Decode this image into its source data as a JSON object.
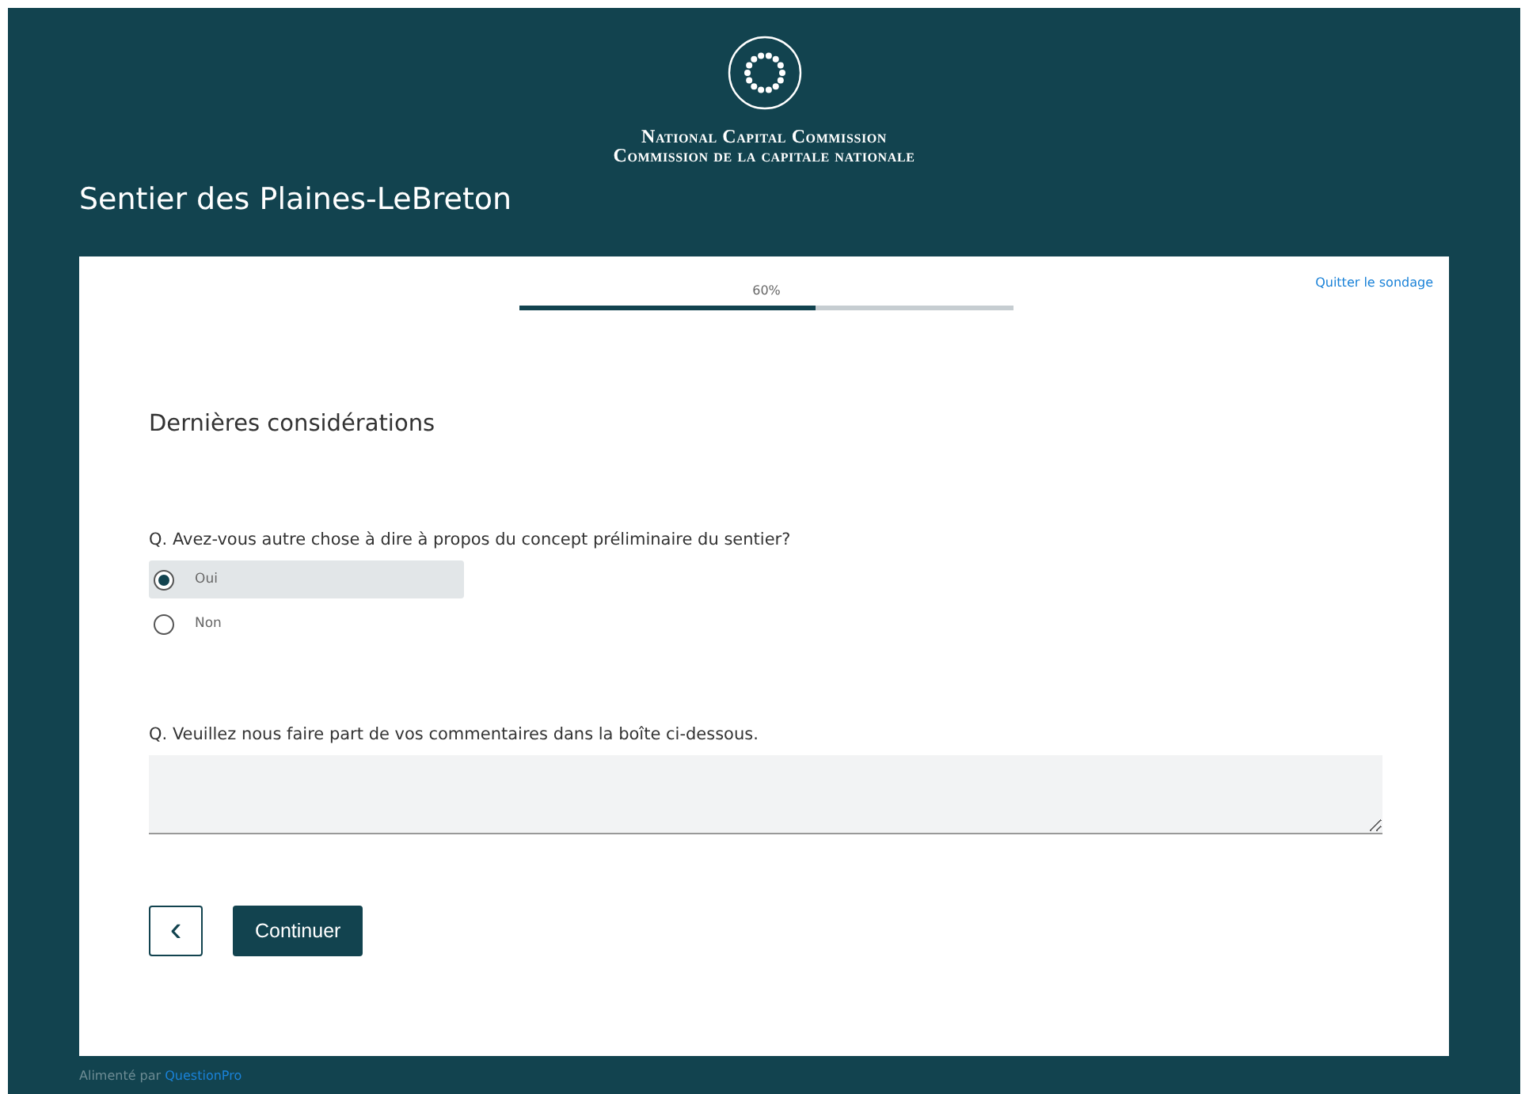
{
  "header": {
    "org_name_en": "National Capital Commission",
    "org_name_fr": "Commission de la capitale nationale"
  },
  "survey_title": "Sentier des Plaines-LeBreton",
  "progress": {
    "label": "60%",
    "level": 0.6
  },
  "exit_link": "Quitter le sondage",
  "section_title": "Dernières considérations",
  "questions": [
    {
      "kind": "radio",
      "text": "Q.  Avez-vous autre chose à dire à propos du concept préliminaire du sentier?",
      "options": [
        {
          "label": "Oui",
          "selected": true
        },
        {
          "label": "Non",
          "selected": false
        }
      ]
    },
    {
      "kind": "textarea",
      "text": "Q.  Veuillez nous faire part de vos commentaires dans la boîte ci-dessous."
    }
  ],
  "buttons": {
    "back": "‹",
    "continue": "Continuer"
  },
  "footer": {
    "text": "Alimenté par",
    "link": "QuestionPro"
  }
}
